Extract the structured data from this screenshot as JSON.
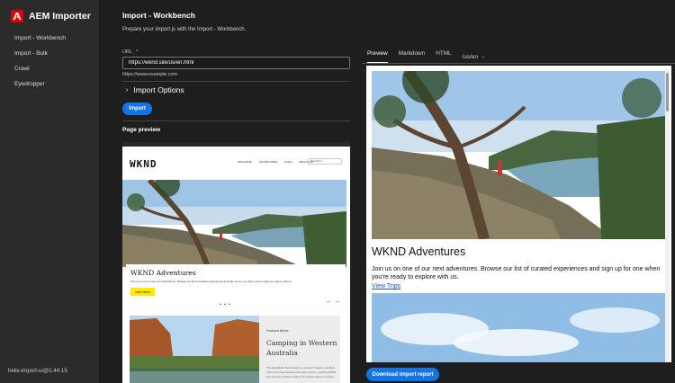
{
  "app": {
    "title": "AEM Importer"
  },
  "sidebar": {
    "items": [
      {
        "label": "Import - Workbench"
      },
      {
        "label": "Import - Bulk"
      },
      {
        "label": "Crawl"
      },
      {
        "label": "Eyedropper"
      }
    ],
    "version": "helix-import-ui@1.44.15"
  },
  "workbench": {
    "title": "Import - Workbench",
    "subtitle": "Prepare your import.js with the Import - Workbench.",
    "url_label": "URL",
    "url_required_marker": "*",
    "url_value": "https://wknd.site/us/en.html",
    "url_help": "https://www.example.com",
    "import_options_label": "Import Options",
    "import_button": "Import",
    "page_preview_heading": "Page preview"
  },
  "page_preview": {
    "logo": "WKND",
    "nav": [
      "MAGAZINE",
      "ADVENTURES",
      "FAQS",
      "ABOUT US"
    ],
    "search_placeholder": "SEARCH",
    "hero_title": "WKND Adventures",
    "hero_text": "Join us on one of our next adventures. Browse our list of curated experiences and sign up for one when you're ready to explore with us.",
    "hero_button": "VIEW TRIPS",
    "dots": "• • •",
    "arrows": "← →",
    "feature_label": "Featured Article",
    "feature_title": "Camping in Western Australia",
    "feature_text": "The Australian West coast is a camper's heaven. Endless miles of remote beaches and sand dunes, roaming wildlife and a lot of sunshine make it the perfect place to explore."
  },
  "right_pane": {
    "tabs": [
      "Preview",
      "Markdown",
      "HTML"
    ],
    "active_tab": "Preview",
    "path_select": "/us/en",
    "preview_title": "WKND Adventures",
    "preview_text": "Join us on one of our next adventures. Browse our list of curated experiences and sign up for one when you're ready to explore with us.",
    "preview_link": "View Trips",
    "download_button": "Download import report"
  },
  "colors": {
    "accent": "#1473e6",
    "brand": "#e30000",
    "sidebar_bg": "#2b2b2b",
    "app_bg": "#1e1e1e"
  }
}
